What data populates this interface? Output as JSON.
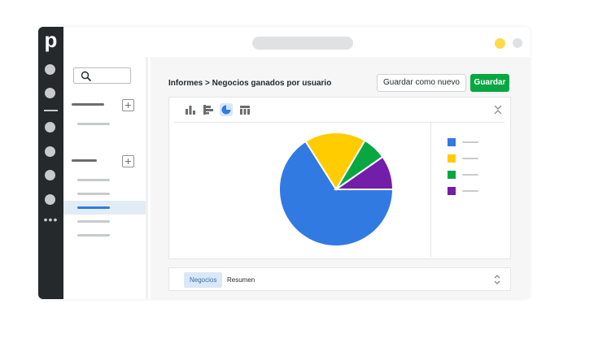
{
  "logo": {
    "letter": "p"
  },
  "sidebar": {
    "search": {
      "icon": "search-icon"
    }
  },
  "header": {
    "breadcrumb": "Informes > Negocios ganados por usuario",
    "save_as_new_label": "Guardar como nuevo",
    "save_label": "Guardar"
  },
  "chart_toolbar": {
    "icons": [
      "bar-chart-icon",
      "horizontal-bar-chart-icon",
      "pie-chart-icon",
      "table-icon"
    ],
    "active": "pie-chart-icon",
    "collapse_icon": "collapse-icon"
  },
  "chart_data": {
    "type": "pie",
    "values": [
      68,
      18,
      7,
      10
    ],
    "colors": [
      "#317ae2",
      "#ffcc00",
      "#08a742",
      "#721ea9"
    ]
  },
  "tabs": [
    {
      "label": "Negocios",
      "active": true
    },
    {
      "label": "Resumen",
      "active": false
    }
  ],
  "colors": {
    "rail": "#26292c",
    "accent_green": "#08a742",
    "accent_blue": "#317ae2",
    "window_dot_yellow": "#ffd94a",
    "window_dot_gray": "#e0e1e2"
  }
}
